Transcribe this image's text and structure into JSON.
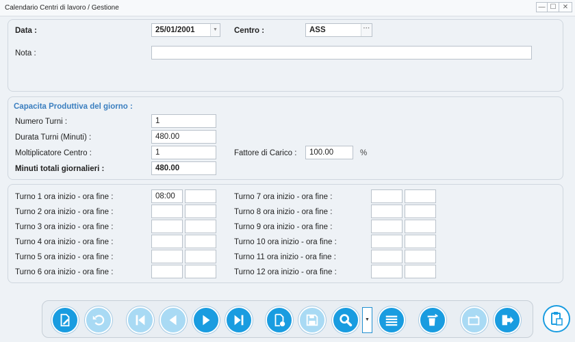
{
  "window": {
    "title": "Calendario Centri di lavoro / Gestione",
    "minimize": "—",
    "maximize": "☐",
    "close": "✕"
  },
  "header": {
    "data_label": "Data :",
    "data_value": "25/01/2001",
    "dropdown_glyph": "▼",
    "centro_label": "Centro :",
    "centro_value": "ASS",
    "browse_glyph": "···",
    "nota_label": "Nota :",
    "nota_value": ""
  },
  "capacity": {
    "section_title": "Capacita Produttiva del giorno :",
    "numero_turni_label": "Numero Turni :",
    "numero_turni_value": "1",
    "durata_turni_label": "Durata Turni (Minuti) :",
    "durata_turni_value": "480.00",
    "moltiplicatore_label": "Moltiplicatore Centro :",
    "moltiplicatore_value": "1",
    "fattore_label": "Fattore di Carico :",
    "fattore_value": "100.00",
    "fattore_unit": "%",
    "minuti_label": "Minuti totali giornalieri :",
    "minuti_value": "480.00"
  },
  "shifts": {
    "left": [
      {
        "label": "Turno 1 ora inizio - ora fine :",
        "start": "08:00",
        "end": ""
      },
      {
        "label": "Turno 2 ora inizio - ora fine :",
        "start": "",
        "end": ""
      },
      {
        "label": "Turno 3 ora inizio - ora fine :",
        "start": "",
        "end": ""
      },
      {
        "label": "Turno 4 ora inizio - ora fine :",
        "start": "",
        "end": ""
      },
      {
        "label": "Turno 5 ora inizio - ora fine :",
        "start": "",
        "end": ""
      },
      {
        "label": "Turno 6 ora inizio - ora fine :",
        "start": "",
        "end": ""
      }
    ],
    "right": [
      {
        "label": "Turno 7 ora inizio - ora fine :",
        "start": "",
        "end": ""
      },
      {
        "label": "Turno 8 ora inizio - ora fine :",
        "start": "",
        "end": ""
      },
      {
        "label": "Turno 9 ora inizio - ora fine :",
        "start": "",
        "end": ""
      },
      {
        "label": "Turno 10 ora inizio - ora fine :",
        "start": "",
        "end": ""
      },
      {
        "label": "Turno 11 ora inizio - ora fine :",
        "start": "",
        "end": ""
      },
      {
        "label": "Turno 12 ora inizio - ora fine :",
        "start": "",
        "end": ""
      }
    ]
  },
  "toolbar": {
    "buttons": [
      {
        "name": "edit-document-icon",
        "enabled": true
      },
      {
        "name": "undo-icon",
        "enabled": false
      },
      {
        "name": "first-record-icon",
        "enabled": false
      },
      {
        "name": "previous-record-icon",
        "enabled": false
      },
      {
        "name": "next-record-icon",
        "enabled": true
      },
      {
        "name": "last-record-icon",
        "enabled": true
      },
      {
        "name": "new-document-icon",
        "enabled": true
      },
      {
        "name": "save-icon",
        "enabled": false
      },
      {
        "name": "search-icon",
        "enabled": true
      },
      {
        "name": "list-icon",
        "enabled": true
      },
      {
        "name": "delete-icon",
        "enabled": true
      },
      {
        "name": "print-icon",
        "enabled": false
      },
      {
        "name": "exit-icon",
        "enabled": true
      },
      {
        "name": "clipboard-icon",
        "enabled": true
      }
    ],
    "search_dropdown_glyph": "▼",
    "accent_color": "#199ce0",
    "disabled_color": "#a9daf4",
    "section_title_color": "#3a7ebf"
  }
}
